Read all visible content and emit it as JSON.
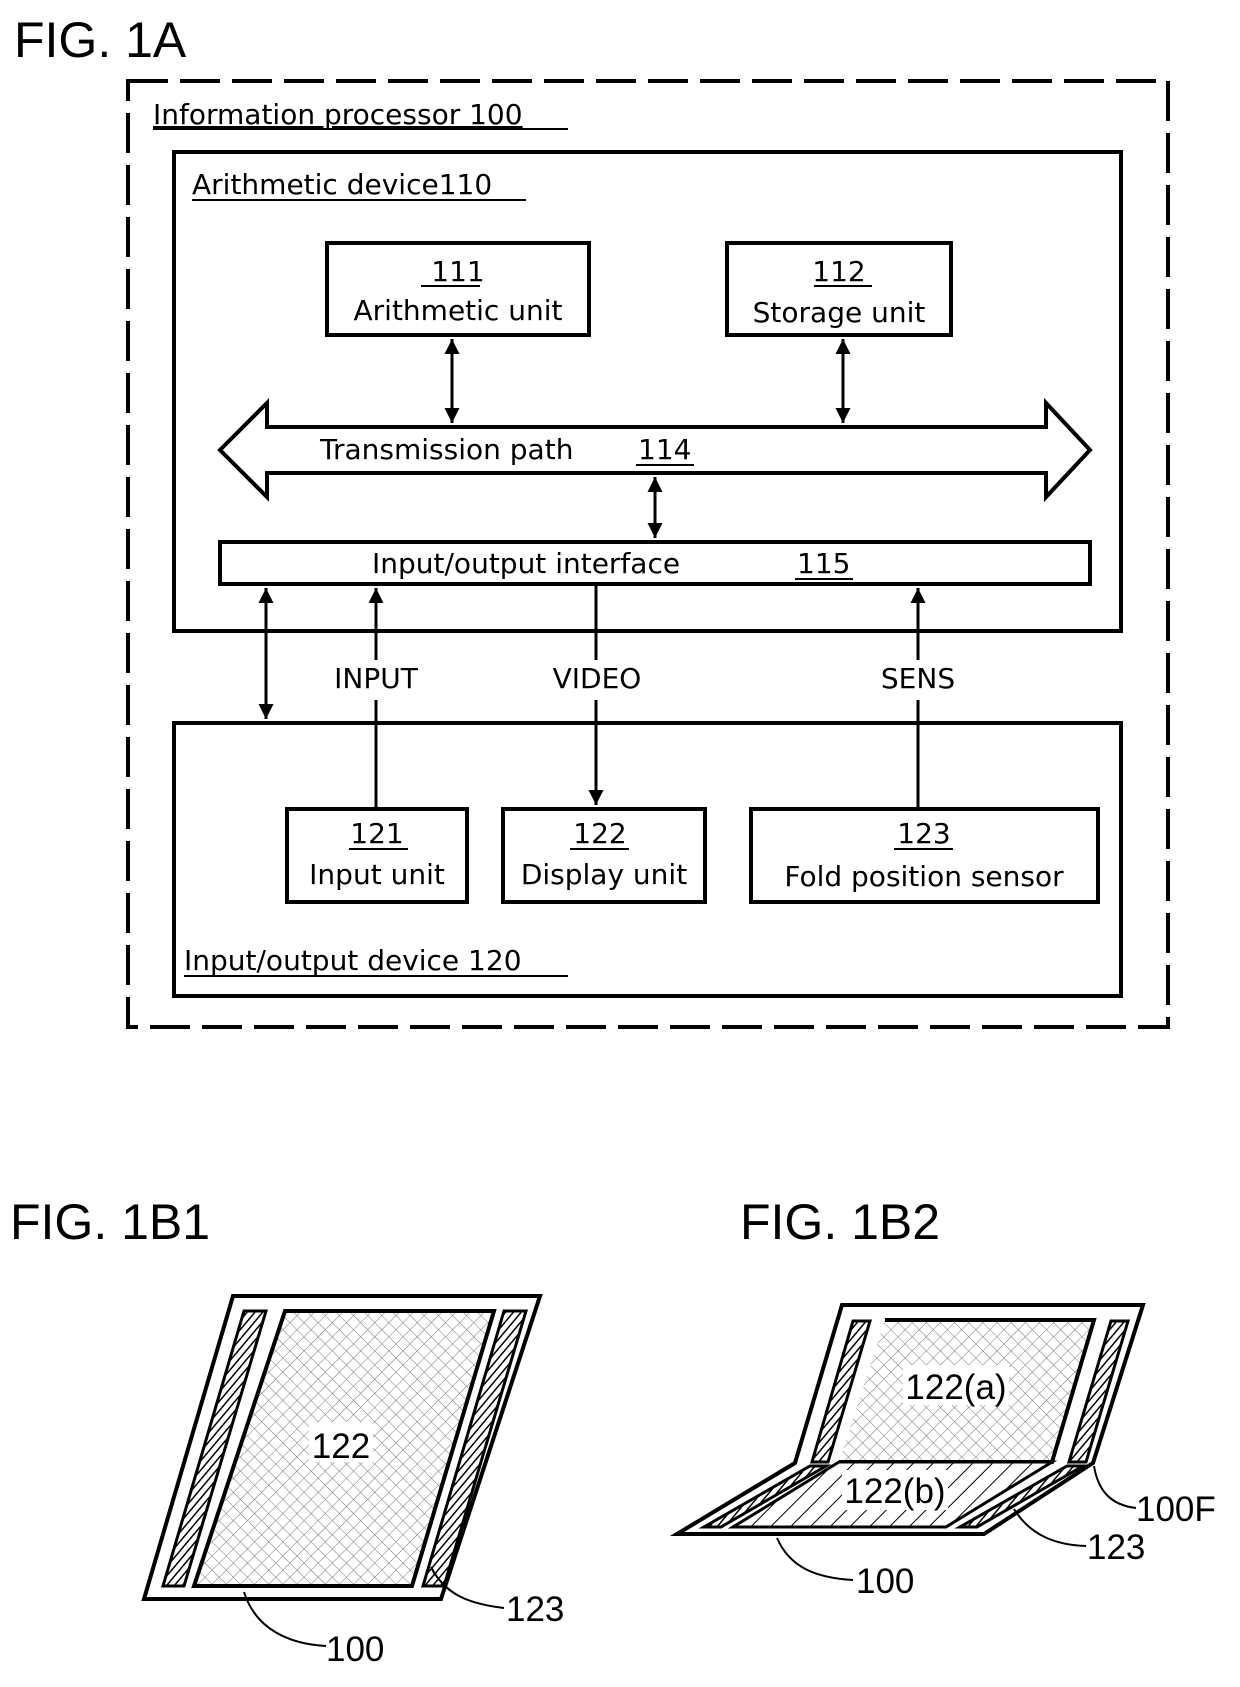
{
  "figures": {
    "fig1a": {
      "title": "FIG. 1A",
      "info_processor": "Information processor 100",
      "arith_device": "Arithmetic device110",
      "arith_unit": {
        "num": "111",
        "label": "Arithmetic unit"
      },
      "storage_unit": {
        "num": "112",
        "label": "Storage unit"
      },
      "transmission_path": {
        "label": "Transmission path",
        "num": "114"
      },
      "io_interface": {
        "label": "Input/output interface",
        "num": "115"
      },
      "signals": {
        "input": "INPUT",
        "video": "VIDEO",
        "sens": "SENS"
      },
      "input_unit": {
        "num": "121",
        "label": "Input unit"
      },
      "display_unit": {
        "num": "122",
        "label": "Display unit"
      },
      "fold_sensor": {
        "num": "123",
        "label": "Fold position sensor"
      },
      "io_device": "Input/output device 120"
    },
    "fig1b1": {
      "title": "FIG. 1B1",
      "display_ref": "122",
      "sensor_ref": "123",
      "device_ref": "100"
    },
    "fig1b2": {
      "title": "FIG. 1B2",
      "display_a_ref": "122(a)",
      "display_b_ref": "122(b)",
      "fold_ref": "100F",
      "sensor_ref": "123",
      "device_ref": "100"
    }
  }
}
